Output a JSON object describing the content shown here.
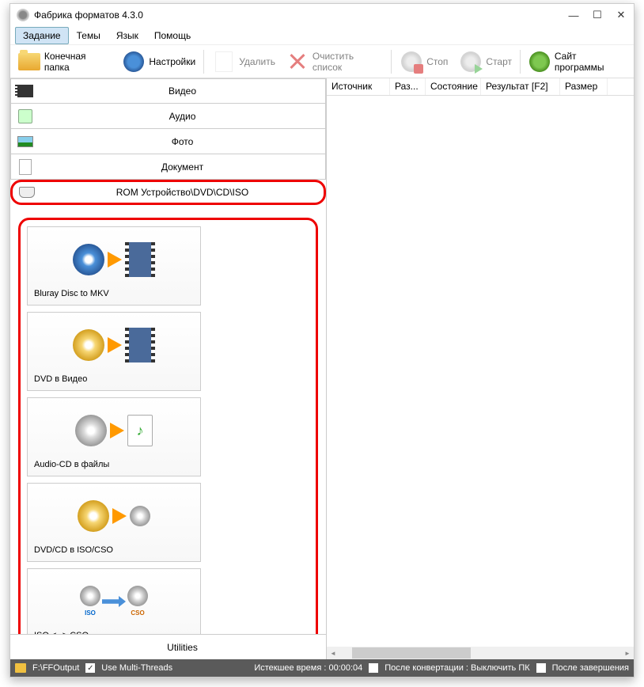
{
  "title": "Фабрика форматов 4.3.0",
  "menu": {
    "items": [
      "Задание",
      "Темы",
      "Язык",
      "Помощь"
    ],
    "active_index": 0
  },
  "toolbar": {
    "dest_folder": "Конечная папка",
    "settings": "Настройки",
    "delete": "Удалить",
    "clear_list": "Очистить список",
    "stop": "Стоп",
    "start": "Старт",
    "site": "Сайт программы"
  },
  "categories": {
    "video": "Видео",
    "audio": "Аудио",
    "photo": "Фото",
    "document": "Документ",
    "rom": "ROM Устройство\\DVD\\CD\\ISO",
    "utilities": "Utilities"
  },
  "rom_options": {
    "bluray_mkv": "Bluray Disc to MKV",
    "dvd_video": "DVD в Видео",
    "audiocd": "Audio-CD в файлы",
    "dvdcd_iso": "DVD/CD в ISO/CSO",
    "iso_cso": "ISO <--> CSO"
  },
  "table_columns": {
    "source": "Источник",
    "size": "Раз...",
    "state": "Состояние",
    "result": "Результат [F2]",
    "filesize": "Размер"
  },
  "status": {
    "output_path": "F:\\FFOutput",
    "multithread_label": "Use Multi-Threads",
    "multithread_checked": true,
    "elapsed_label": "Истекшее время : 00:00:04",
    "after_convert_label": "После конвертации : Выключить ПК",
    "after_convert_checked": false,
    "after_complete_label": "После завершения",
    "after_complete_checked": false
  }
}
